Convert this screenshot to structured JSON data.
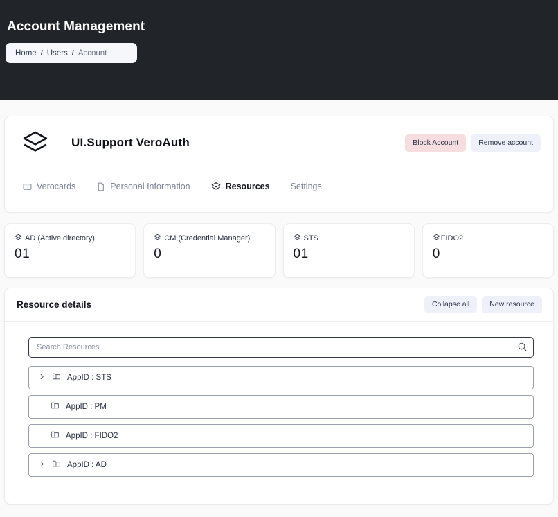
{
  "header": {
    "title": "Account Management",
    "breadcrumb": {
      "home": "Home",
      "users": "Users",
      "account": "Account",
      "separator": "/"
    }
  },
  "account": {
    "logo_icon": "layers-icon",
    "name": "UI.Support VeroAuth",
    "actions": {
      "block_label": "Block Account",
      "block_bg": "#f5dde0",
      "remove_label": "Remove account",
      "remove_bg": "#eef0fa"
    },
    "tabs": [
      {
        "label": "Verocards",
        "icon": "card-icon",
        "active": false
      },
      {
        "label": "Personal Information",
        "icon": "document-icon",
        "active": false
      },
      {
        "label": "Resources",
        "icon": "layers-icon",
        "active": true
      },
      {
        "label": "Settings",
        "icon": "none",
        "active": false
      }
    ]
  },
  "stats": [
    {
      "icon": "layers-icon",
      "label": "AD (Active directory)",
      "value": "01"
    },
    {
      "icon": "layers-icon",
      "label": "CM (Credential Manager)",
      "value": "0"
    },
    {
      "icon": "layers-icon",
      "label": "STS",
      "value": "01"
    },
    {
      "icon": "layers-icon",
      "label": "FIDO2",
      "value": "0"
    }
  ],
  "resources": {
    "title": "Resource details",
    "collapse_label": "Collapse all",
    "new_label": "New resource",
    "search": {
      "placeholder": "Search Resources...",
      "value": "",
      "icon": "search-icon"
    },
    "tree": [
      {
        "label": "AppID : STS",
        "expandable": true,
        "icon": "folder-icon"
      },
      {
        "label": "AppID : PM",
        "expandable": false,
        "icon": "folder-icon"
      },
      {
        "label": "AppID : FIDO2",
        "expandable": false,
        "icon": "folder-icon"
      },
      {
        "label": "AppID : AD",
        "expandable": true,
        "icon": "folder-icon"
      }
    ]
  },
  "colors": {
    "header_bg": "#212529",
    "page_bg": "#fafafa",
    "accent_light": "#eef0fa",
    "danger_light": "#f5dde0"
  }
}
